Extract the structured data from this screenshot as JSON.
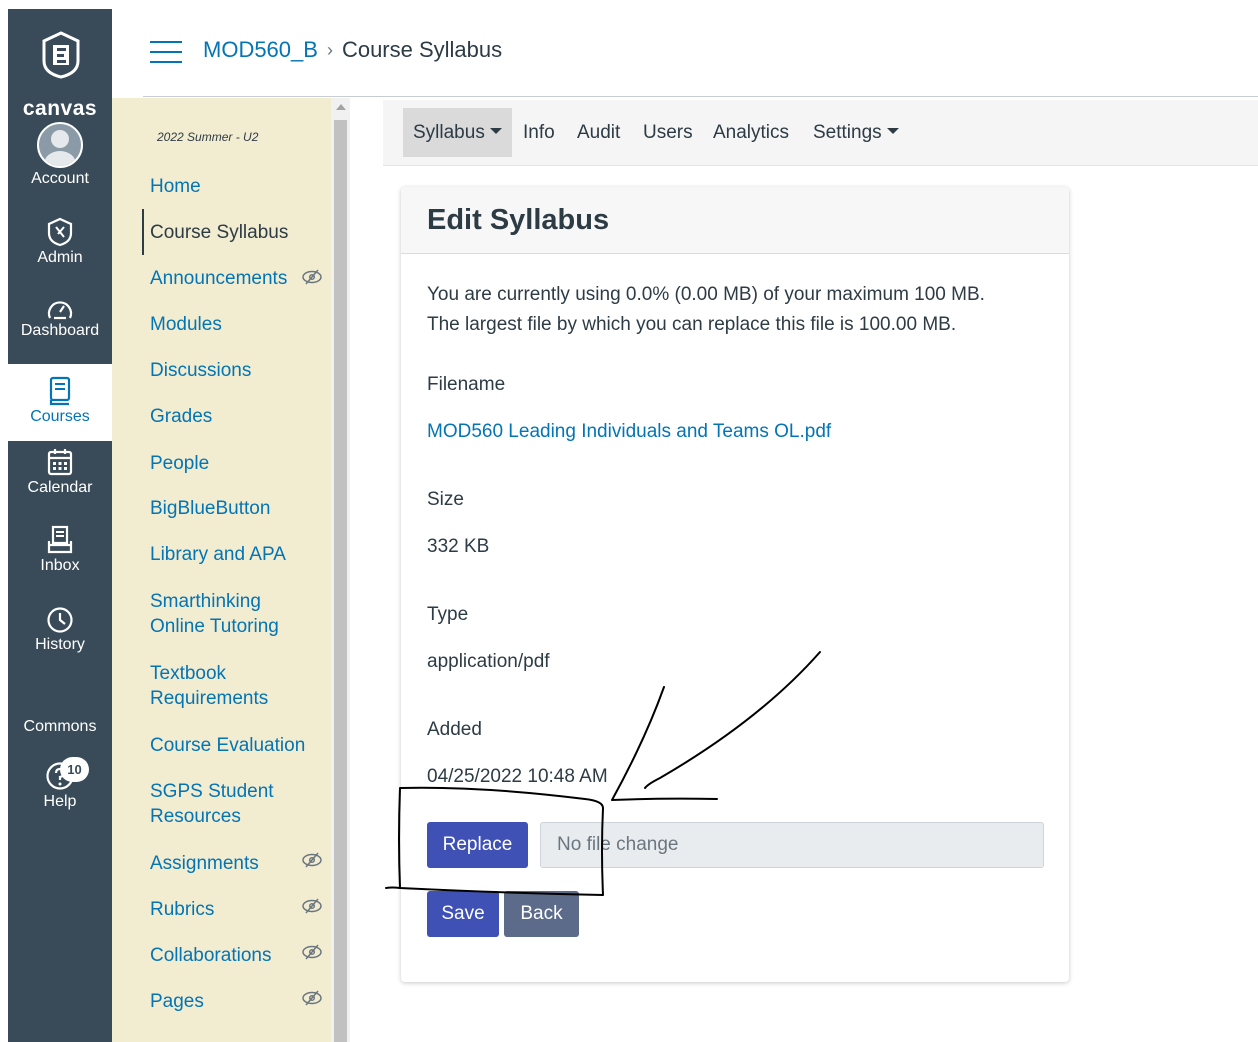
{
  "global_nav": {
    "logo_text": "canvas",
    "items": [
      {
        "label": "Account",
        "icon": "user-icon"
      },
      {
        "label": "Admin",
        "icon": "shield-icon"
      },
      {
        "label": "Dashboard",
        "icon": "dashboard-icon"
      },
      {
        "label": "Courses",
        "icon": "book-icon"
      },
      {
        "label": "Calendar",
        "icon": "calendar-icon"
      },
      {
        "label": "Inbox",
        "icon": "inbox-icon"
      },
      {
        "label": "History",
        "icon": "clock-icon"
      },
      {
        "label": "Commons",
        "icon": ""
      },
      {
        "label": "Help",
        "icon": "help-icon",
        "badge": "10"
      }
    ]
  },
  "header": {
    "course_link": "MOD560_B",
    "separator": "›",
    "current_page": "Course Syllabus"
  },
  "course_nav": {
    "term": "2022 Summer - U2",
    "items": [
      {
        "label": "Home"
      },
      {
        "label": "Course Syllabus",
        "active": true
      },
      {
        "label": "Announcements",
        "hidden": true
      },
      {
        "label": "Modules"
      },
      {
        "label": "Discussions"
      },
      {
        "label": "Grades"
      },
      {
        "label": "People"
      },
      {
        "label": "BigBlueButton"
      },
      {
        "label": "Library and APA"
      },
      {
        "label": "Smarthinking",
        "label2": "Online Tutoring"
      },
      {
        "label": "Textbook",
        "label2": "Requirements"
      },
      {
        "label": "Course Evaluation"
      },
      {
        "label": "SGPS Student",
        "label2": "Resources"
      },
      {
        "label": "Assignments",
        "hidden": true
      },
      {
        "label": "Rubrics",
        "hidden": true
      },
      {
        "label": "Collaborations",
        "hidden": true
      },
      {
        "label": "Pages",
        "hidden": true
      }
    ]
  },
  "subtabs": [
    {
      "label": "Syllabus",
      "dropdown": true,
      "active": true
    },
    {
      "label": "Info"
    },
    {
      "label": "Audit"
    },
    {
      "label": "Users"
    },
    {
      "label": "Analytics"
    },
    {
      "label": "Settings",
      "dropdown": true
    }
  ],
  "card": {
    "title": "Edit Syllabus",
    "usage_line1": "You are currently using 0.0% (0.00 MB) of your maximum 100 MB.",
    "usage_line2": "The largest file by which you can replace this file is 100.00 MB.",
    "filename_label": "Filename",
    "filename_value": "MOD560 Leading Individuals and Teams OL.pdf",
    "size_label": "Size",
    "size_value": "332 KB",
    "type_label": "Type",
    "type_value": "application/pdf",
    "added_label": "Added",
    "added_value": "04/25/2022 10:48 AM",
    "replace_button": "Replace",
    "file_input_text": "No file change",
    "save_button": "Save",
    "back_button": "Back"
  },
  "colors": {
    "global_nav_bg": "#394b58",
    "course_nav_bg": "#f2edd1",
    "link": "#0374b5",
    "primary_button": "#3f51b5",
    "secondary_button": "#5c6b8a"
  }
}
